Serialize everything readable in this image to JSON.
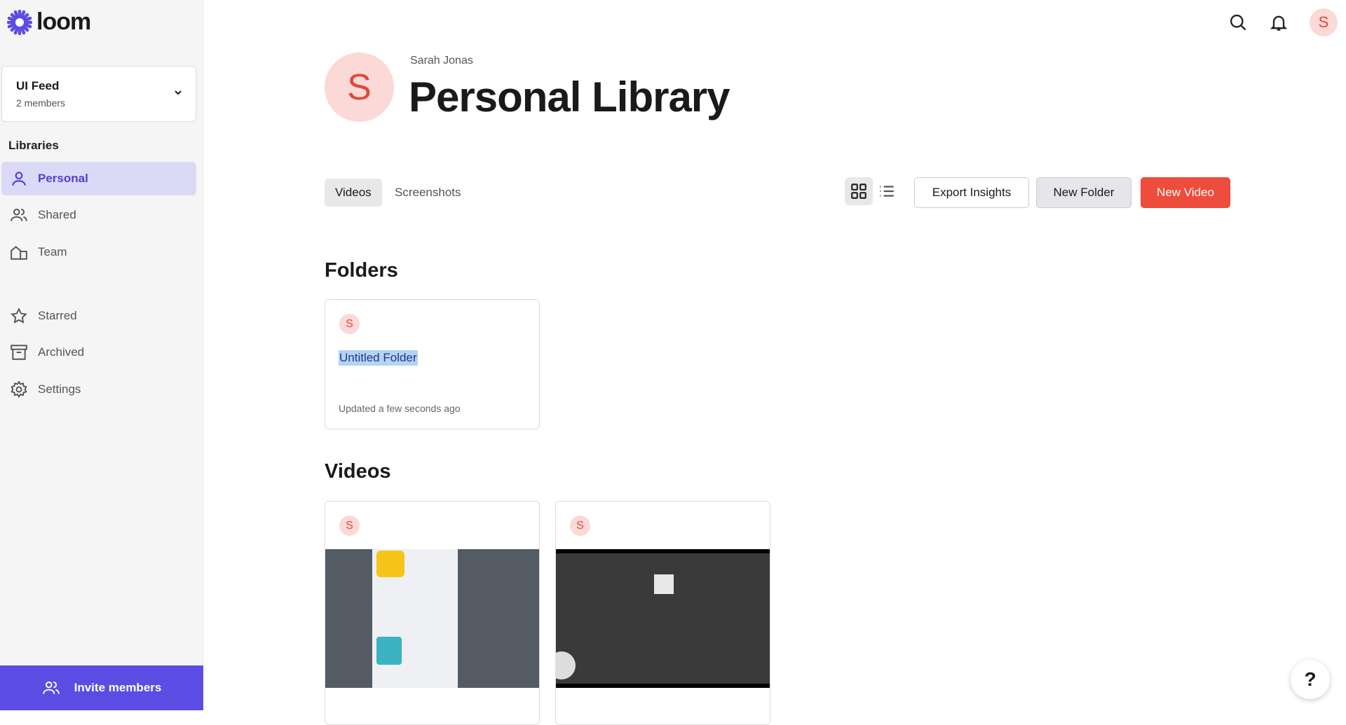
{
  "brand": {
    "name": "loom",
    "color": "#5b4ce4"
  },
  "workspace": {
    "name": "UI Feed",
    "members": "2 members"
  },
  "sidebar": {
    "section_label": "Libraries",
    "items": [
      {
        "label": "Personal",
        "icon": "person-icon",
        "active": true
      },
      {
        "label": "Shared",
        "icon": "people-icon"
      },
      {
        "label": "Team",
        "icon": "building-icon"
      },
      {
        "label": "Starred",
        "icon": "star-icon"
      },
      {
        "label": "Archived",
        "icon": "archive-icon"
      },
      {
        "label": "Settings",
        "icon": "gear-icon"
      }
    ],
    "invite_label": "Invite members"
  },
  "header": {
    "user_initial": "S",
    "owner": "Sarah Jonas",
    "title": "Personal Library"
  },
  "tabs": [
    {
      "label": "Videos",
      "active": true
    },
    {
      "label": "Screenshots"
    }
  ],
  "toolbar": {
    "view": "grid",
    "export": "Export Insights",
    "new_folder": "New Folder",
    "new_video": "New Video",
    "accent": "#ee4c3c"
  },
  "folders": {
    "heading": "Folders",
    "items": [
      {
        "initial": "S",
        "name": "Untitled Folder",
        "updated": "Updated a few seconds ago"
      }
    ]
  },
  "videos": {
    "heading": "Videos",
    "items": [
      {
        "initial": "S"
      },
      {
        "initial": "S"
      }
    ]
  },
  "help": "?"
}
